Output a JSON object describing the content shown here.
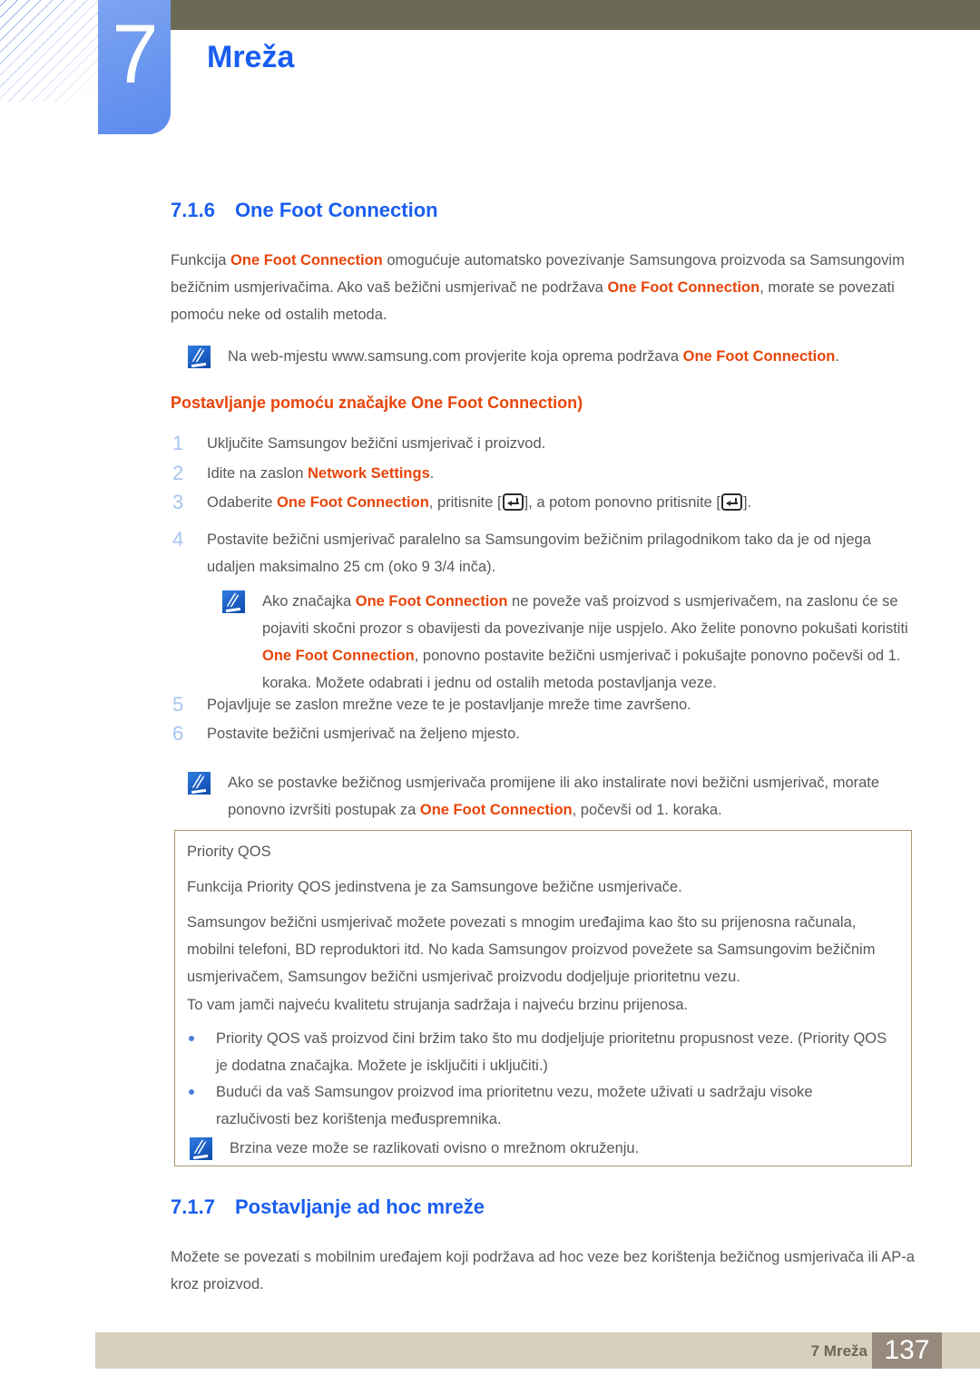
{
  "header": {
    "chapter_number": "7",
    "chapter_title": "Mreža"
  },
  "sections": {
    "s716": {
      "num": "7.1.6",
      "title": "One Foot Connection"
    },
    "s717": {
      "num": "7.1.7",
      "title": "Postavljanje ad hoc mreže"
    }
  },
  "intro": {
    "t1": "Funkcija ",
    "hl1": "One Foot Connection",
    "t2": " omogućuje automatsko povezivanje Samsungova proizvoda sa Samsungovim bežičnim usmjerivačima. Ako vaš bežični usmjerivač ne podržava ",
    "hl2": "One Foot Connection",
    "t3": ", morate se povezati pomoću neke od ostalih metoda."
  },
  "note1": {
    "icon": "note-pencil-icon",
    "t1": "Na web-mjestu www.samsung.com provjerite koja oprema podržava ",
    "hl1": "One Foot Connection",
    "t2": "."
  },
  "subheading": "Postavljanje pomoću značajke One Foot Connection)",
  "steps": [
    {
      "num": "1",
      "t1": "Uključite Samsungov bežični usmjerivač i proizvod.",
      "hl1": "",
      "t2": ""
    },
    {
      "num": "2",
      "t1": "Idite na zaslon ",
      "hl1": "Network Settings",
      "t2": "."
    },
    {
      "num": "3",
      "t1": "Odaberite ",
      "hl1": "One Foot Connection",
      "t2": ", pritisnite [",
      "t3": "], a potom ponovno pritisnite [",
      "t4": "]."
    },
    {
      "num": "4",
      "t1": "Postavite bežični usmjerivač paralelno sa Samsungovim bežičnim prilagodnikom tako da je od njega udaljen maksimalno 25 cm (oko 9 3/4 inča).",
      "hl1": "",
      "t2": ""
    },
    {
      "num": "5",
      "t1": "Pojavljuje se zaslon mrežne veze te je postavljanje mreže time završeno.",
      "hl1": "",
      "t2": ""
    },
    {
      "num": "6",
      "t1": "Postavite bežični usmjerivač na željeno mjesto.",
      "hl1": "",
      "t2": ""
    }
  ],
  "note2": {
    "icon": "note-pencil-icon",
    "t1": "Ako značajka ",
    "hl1": "One Foot Connection",
    "t2": " ne poveže vaš proizvod s usmjerivačem, na zaslonu će se pojaviti skočni prozor s obavijesti da povezivanje nije uspjelo. Ako želite ponovno pokušati koristiti ",
    "hl2": "One Foot Connection",
    "t3": ", ponovno postavite bežični usmjerivač i pokušajte ponovno počevši od 1. koraka. Možete odabrati i jednu od ostalih metoda postavljanja veze."
  },
  "note3": {
    "icon": "note-pencil-icon",
    "t1": "Ako se postavke bežičnog usmjerivača promijene ili ako instalirate novi bežični usmjerivač, morate ponovno izvršiti postupak za ",
    "hl1": "One Foot Connection",
    "t2": ", počevši od 1. koraka."
  },
  "qos": {
    "title": "Priority QOS",
    "p1": "Funkcija Priority QOS jedinstvena je za Samsungove bežične usmjerivače.",
    "p2": "Samsungov bežični usmjerivač možete povezati s mnogim uređajima kao što su prijenosna računala, mobilni telefoni, BD reproduktori itd. No kada Samsungov proizvod povežete sa Samsungovim bežičnim usmjerivačem, Samsungov bežični usmjerivač proizvodu dodjeljuje prioritetnu vezu.",
    "p3": "To vam jamči najveću kvalitetu strujanja sadržaja i najveću brzinu prijenosa.",
    "bullets": [
      "Priority QOS vaš proizvod čini bržim tako što mu dodjeljuje prioritetnu propusnost veze. (Priority QOS je dodatna značajka. Možete je isključiti i uključiti.)",
      "Budući da vaš Samsungov proizvod ima prioritetnu vezu, možete uživati u sadržaju visoke razlučivosti bez korištenja međuspremnika."
    ],
    "note": {
      "icon": "note-pencil-icon",
      "text": "Brzina veze može se razlikovati ovisno o mrežnom okruženju."
    }
  },
  "adhoc": {
    "p1": "Možete se povezati s mobilnim uređajem koji podržava ad hoc veze bez korištenja bežičnog usmjerivača ili AP-a kroz proizvod."
  },
  "footer": {
    "label": "7 Mreža",
    "page": "137"
  },
  "colors": {
    "accent_blue": "#1a5ef0",
    "highlight_orange": "#e8450a",
    "olive_bar": "#6c6a56",
    "box_border": "#a89968",
    "footer_bar": "#d6d1bd",
    "footer_page": "#98897d",
    "body_text": "#58585a",
    "step_number": "#a8c4f0"
  }
}
